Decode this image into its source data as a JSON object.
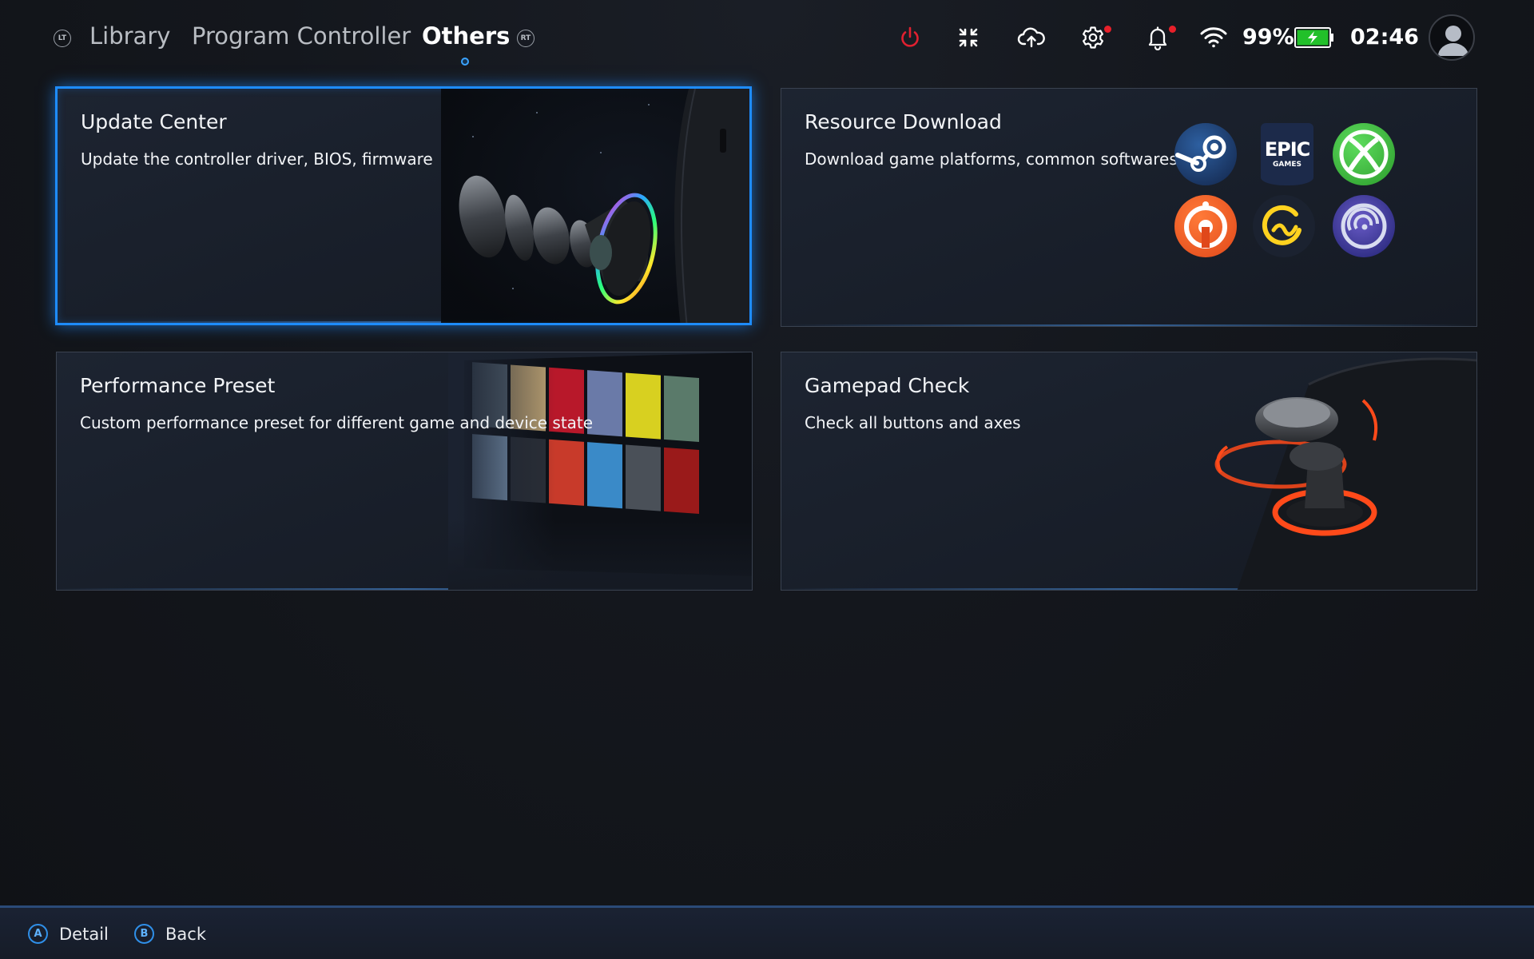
{
  "topbar": {
    "lt_badge": "LT",
    "rt_badge": "RT",
    "tabs": [
      {
        "label": "Library"
      },
      {
        "label": "Program Controller"
      },
      {
        "label": "Others"
      }
    ],
    "active_tab": "Others",
    "battery_percent": "99%",
    "time": "02:46",
    "icons": [
      "power-icon",
      "fullscreen-exit-icon",
      "cloud-upload-icon",
      "gear-icon",
      "bell-icon",
      "wifi-icon",
      "battery-charging-icon",
      "avatar-icon"
    ]
  },
  "cards": [
    {
      "title": "Update Center",
      "desc": "Update the controller driver, BIOS, firmware"
    },
    {
      "title": "Resource Download",
      "desc": "Download game platforms, common softwares"
    },
    {
      "title": "Performance Preset",
      "desc": "Custom performance preset for different game and device state"
    },
    {
      "title": "Gamepad Check",
      "desc": "Check all buttons and axes"
    }
  ],
  "platforms": {
    "epic_top": "EPIC",
    "epic_bottom": "GAMES",
    "items": [
      "steam-icon",
      "epic-games-icon",
      "xbox-icon",
      "origin-icon",
      "gog-galaxy-icon",
      "ubisoft-icon"
    ]
  },
  "bottombar": {
    "hints": [
      {
        "button": "A",
        "label": "Detail"
      },
      {
        "button": "B",
        "label": "Back"
      }
    ]
  },
  "colors": {
    "accent": "#1e8cff",
    "power": "#e02030",
    "notification": "#e8202a",
    "battery": "#22c02a"
  }
}
